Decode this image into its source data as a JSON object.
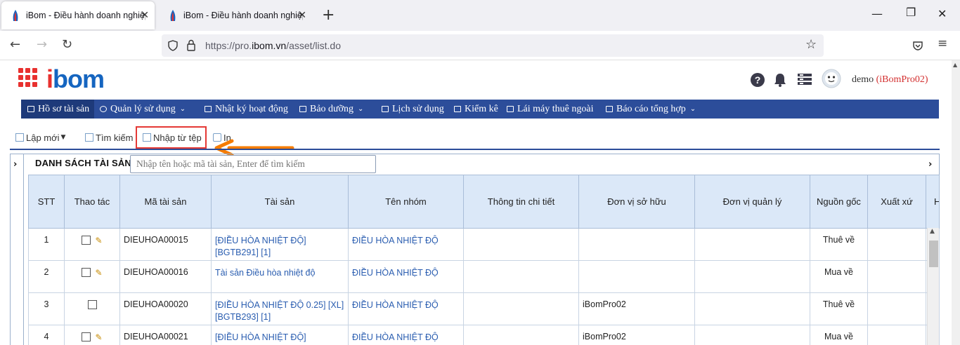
{
  "browser": {
    "tabs": [
      {
        "title": "iBom - Điều hành doanh nghiệp",
        "active": true
      },
      {
        "title": "iBom - Điều hành doanh nghiệp",
        "active": false
      }
    ],
    "url_prefix": "https://pro.",
    "url_domain": "ibom.vn",
    "url_path": "/asset/list.do"
  },
  "app": {
    "logo_i": "i",
    "logo_rest": "bom",
    "user_name": "demo",
    "user_org": "(iBomPro02)"
  },
  "menu": [
    {
      "label": "Hồ sơ tài sản",
      "icon": "grid-icon",
      "active": true,
      "caret": false
    },
    {
      "label": "Quản lý sử dụng",
      "icon": "recycle-icon",
      "active": false,
      "caret": true
    },
    {
      "label": "Nhật ký hoạt động",
      "icon": "car-icon",
      "active": false,
      "caret": false
    },
    {
      "label": "Bảo dưỡng",
      "icon": "wrench-icon",
      "active": false,
      "caret": true
    },
    {
      "label": "Lịch sử dụng",
      "icon": "calendar-icon",
      "active": false,
      "caret": false
    },
    {
      "label": "Kiểm kê",
      "icon": "copy-icon",
      "active": false,
      "caret": false
    },
    {
      "label": "Lái máy thuê ngoài",
      "icon": "id-card-icon",
      "active": false,
      "caret": false
    },
    {
      "label": "Báo cáo tổng hợp",
      "icon": "monitor-icon",
      "active": false,
      "caret": true
    }
  ],
  "toolbar": {
    "new_label": "Lập mới",
    "search_label": "Tìm kiếm",
    "import_label": "Nhập từ tệp",
    "print_label": "In"
  },
  "panel": {
    "title": "DANH SÁCH TÀI SẢN",
    "search_placeholder": "Nhập tên hoặc mã tài sản, Enter để tìm kiếm"
  },
  "table": {
    "columns": [
      "STT",
      "Thao tác",
      "Mã tài sản",
      "Tài sản",
      "Tên nhóm",
      "Thông tin chi tiết",
      "Đơn vị sở hữu",
      "Đơn vị quản lý",
      "Nguồn gốc",
      "Xuất xứ",
      "H"
    ],
    "rows": [
      {
        "stt": "1",
        "edit": true,
        "code": "DIEUHOA00015",
        "asset_1": "[ĐIỀU HÒA NHIỆT ĐỘ]",
        "asset_2": "[BGTB291] [1]",
        "group": "ĐIỀU HÒA NHIỆT ĐỘ",
        "detail": "",
        "owner": "",
        "manager": "",
        "origin": "Thuê về",
        "made_in": ""
      },
      {
        "stt": "2",
        "edit": true,
        "code": "DIEUHOA00016",
        "asset_1": "Tài sản Điều hòa nhiệt độ",
        "asset_2": "",
        "group": "ĐIỀU HÒA NHIỆT ĐỘ",
        "detail": "",
        "owner": "",
        "manager": "",
        "origin": "Mua về",
        "made_in": ""
      },
      {
        "stt": "3",
        "edit": false,
        "code": "DIEUHOA00020",
        "asset_1": "[ĐIỀU HÒA NHIỆT ĐỘ 0.25] [XL]",
        "asset_2": "[BGTB293] [1]",
        "group": "ĐIỀU HÒA NHIỆT ĐỘ",
        "detail": "",
        "owner": "iBomPro02",
        "manager": "",
        "origin": "Thuê về",
        "made_in": ""
      },
      {
        "stt": "4",
        "edit": true,
        "code": "DIEUHOA00021",
        "asset_1": "[ĐIỀU HÒA NHIỆT ĐỘ]",
        "asset_2": "",
        "group": "ĐIỀU HÒA NHIỆT ĐỘ",
        "detail": "",
        "owner": "iBomPro02",
        "manager": "",
        "origin": "Mua về",
        "made_in": ""
      }
    ]
  },
  "colors": {
    "menu_bg": "#2c4d9a",
    "header_bg": "#dbe8f8",
    "link": "#2a5db0",
    "highlight": "#e53935",
    "arrow": "#f57c00"
  }
}
